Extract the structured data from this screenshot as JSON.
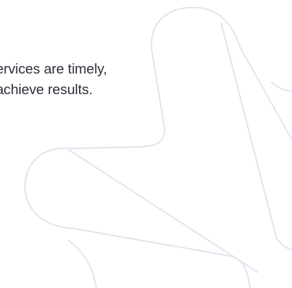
{
  "tagline": {
    "line1": "ervices are timely,",
    "line2": "achieve results."
  },
  "colors": {
    "background": "#ffffff",
    "text": "#2f2f3d",
    "decoration_stroke": "#e7e0ef"
  },
  "decoration": {
    "icon": "rounded-star-outline-icon"
  }
}
